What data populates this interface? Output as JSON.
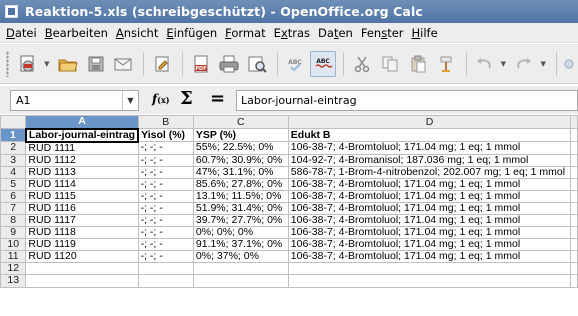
{
  "window": {
    "title": "Reaktion-5.xls (schreibgeschützt) - OpenOffice.org Calc"
  },
  "menu": [
    {
      "pre": "",
      "acc": "D",
      "post": "atei"
    },
    {
      "pre": "",
      "acc": "B",
      "post": "earbeiten"
    },
    {
      "pre": "",
      "acc": "A",
      "post": "nsicht"
    },
    {
      "pre": "",
      "acc": "E",
      "post": "infügen"
    },
    {
      "pre": "",
      "acc": "F",
      "post": "ormat"
    },
    {
      "pre": "E",
      "acc": "x",
      "post": "tras"
    },
    {
      "pre": "Da",
      "acc": "t",
      "post": "en"
    },
    {
      "pre": "Fen",
      "acc": "s",
      "post": "ter"
    },
    {
      "pre": "",
      "acc": "H",
      "post": "ilfe"
    }
  ],
  "toolbar": {
    "icons": [
      "new-document-icon",
      "open-folder-icon",
      "save-icon",
      "email-icon",
      "edit-file-icon",
      "export-pdf-icon",
      "print-icon",
      "page-preview-icon",
      "spellcheck-icon",
      "autospellcheck-icon",
      "cut-icon",
      "copy-icon",
      "paste-icon",
      "format-paintbrush-icon",
      "undo-icon",
      "redo-icon",
      "hyperlink-icon"
    ],
    "spell_label": "ABC",
    "pdf_label": "PDF"
  },
  "formula_bar": {
    "name_box": "A1",
    "fx_label": "f",
    "fx_sub": "(x)",
    "sum_label": "Σ",
    "equals_label": "=",
    "content": "Labor-journal-eintrag"
  },
  "sheet": {
    "columns": [
      "A",
      "B",
      "C",
      "D"
    ],
    "selected_column": "A",
    "selected_row": "1",
    "row_numbers": [
      "1",
      "2",
      "3",
      "4",
      "5",
      "6",
      "7",
      "8",
      "9",
      "10",
      "11",
      "12",
      "13"
    ],
    "header_row": [
      "Labor-journal-eintrag",
      "Yisol (%)",
      "YSP (%)",
      "Edukt B"
    ],
    "rows": [
      [
        "RUD 1111",
        "-; -; -",
        "55%; 22.5%; 0%",
        "106-38-7; 4-Bromtoluol; 171.04 mg; 1 eq; 1 mmol"
      ],
      [
        "RUD 1112",
        "-; -; -",
        "60.7%; 30.9%; 0%",
        "104-92-7; 4-Bromanisol; 187.036 mg; 1 eq; 1 mmol"
      ],
      [
        "RUD 1113",
        "-; -; -",
        "47%; 31.1%; 0%",
        "586-78-7; 1-Brom-4-nitrobenzol; 202.007 mg; 1 eq; 1 mmol"
      ],
      [
        "RUD 1114",
        "-; -; -",
        "85.6%; 27.8%; 0%",
        "106-38-7; 4-Bromtoluol; 171.04 mg; 1 eq; 1 mmol"
      ],
      [
        "RUD 1115",
        "-; -; -",
        "13.1%; 11.5%; 0%",
        "106-38-7; 4-Bromtoluol; 171.04 mg; 1 eq; 1 mmol"
      ],
      [
        "RUD 1116",
        "-; -; -",
        "51.9%; 31.4%; 0%",
        "106-38-7; 4-Bromtoluol; 171.04 mg; 1 eq; 1 mmol"
      ],
      [
        "RUD 1117",
        "-; -; -",
        "39.7%; 27.7%; 0%",
        "106-38-7; 4-Bromtoluol; 171.04 mg; 1 eq; 1 mmol"
      ],
      [
        "RUD 1118",
        "-; -; -",
        "0%; 0%; 0%",
        "106-38-7; 4-Bromtoluol; 171.04 mg; 1 eq; 1 mmol"
      ],
      [
        "RUD 1119",
        "-; -; -",
        "91.1%; 37.1%; 0%",
        "106-38-7; 4-Bromtoluol; 171.04 mg; 1 eq; 1 mmol"
      ],
      [
        "RUD 1120",
        "-; -; -",
        "0%; 37%; 0%",
        "106-38-7; 4-Bromtoluol; 171.04 mg; 1 eq; 1 mmol"
      ],
      [
        "",
        "",
        "",
        ""
      ],
      [
        "",
        "",
        "",
        ""
      ]
    ]
  },
  "colors": {
    "titlebar": "#4f74a6",
    "selected_header": "#6a95c9",
    "chrome": "#ededed"
  }
}
